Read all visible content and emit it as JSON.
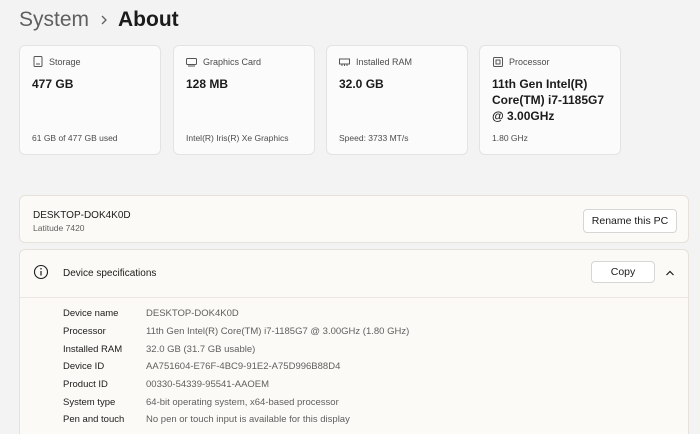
{
  "breadcrumb": {
    "parent": "System",
    "current": "About"
  },
  "cards": [
    {
      "icon": "storage-icon",
      "label": "Storage",
      "value": "477 GB",
      "sub": "61 GB of 477 GB used"
    },
    {
      "icon": "graphics-card-icon",
      "label": "Graphics Card",
      "value": "128 MB",
      "sub": "Intel(R) Iris(R) Xe Graphics"
    },
    {
      "icon": "ram-icon",
      "label": "Installed RAM",
      "value": "32.0 GB",
      "sub": "Speed: 3733 MT/s"
    },
    {
      "icon": "processor-icon",
      "label": "Processor",
      "value": "11th Gen Intel(R) Core(TM) i7-1185G7 @ 3.00GHz",
      "sub": "1.80 GHz"
    }
  ],
  "pc": {
    "name": "DESKTOP-DOK4K0D",
    "model": "Latitude 7420",
    "rename_label": "Rename this PC"
  },
  "device_specs": {
    "title": "Device specifications",
    "copy_label": "Copy",
    "rows": [
      {
        "key": "Device name",
        "value": "DESKTOP-DOK4K0D"
      },
      {
        "key": "Processor",
        "value": "11th Gen Intel(R) Core(TM) i7-1185G7 @ 3.00GHz (1.80 GHz)"
      },
      {
        "key": "Installed RAM",
        "value": "32.0 GB (31.7 GB usable)"
      },
      {
        "key": "Device ID",
        "value": "AA751604-E76F-4BC9-91E2-A75D996B88D4"
      },
      {
        "key": "Product ID",
        "value": "00330-54339-95541-AAOEM"
      },
      {
        "key": "System type",
        "value": "64-bit operating system, x64-based processor"
      },
      {
        "key": "Pen and touch",
        "value": "No pen or touch input is available for this display"
      }
    ]
  }
}
